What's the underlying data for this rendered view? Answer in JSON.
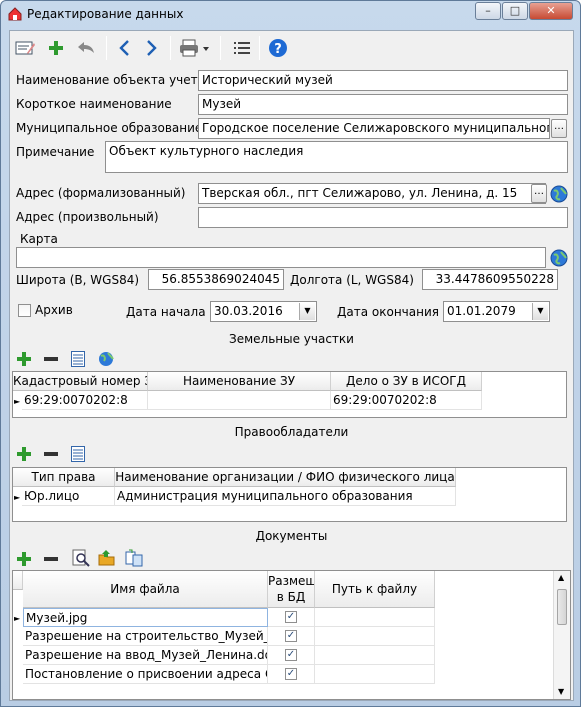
{
  "window": {
    "title": "Редактирование данных"
  },
  "toolbar": {
    "icons": [
      "edit-icon",
      "add-icon",
      "undo-icon",
      "back-icon",
      "forward-icon",
      "print-icon",
      "list-icon",
      "help-icon"
    ]
  },
  "form": {
    "name_label": "Наименование объекта учета",
    "name_value": "Исторический музей",
    "short_label": "Короткое наименование",
    "short_value": "Музей",
    "municipal_label": "Муниципальное образование",
    "municipal_value": "Городское поселение Селижаровского муниципального рай",
    "note_label": "Примечание",
    "note_value": "Объект культурного наследия",
    "address_label": "Адрес (формализованный)",
    "address_value": "Тверская обл., пгт Селижарово, ул. Ленина, д. 15",
    "address_free_label": "Адрес (произвольный)",
    "address_free_value": "",
    "map_label": "Карта",
    "map_value": "",
    "lat_label": "Широта (B, WGS84)",
    "lat_value": "56.8553869024045",
    "lon_label": "Долгота (L, WGS84)",
    "lon_value": "33.4478609550228",
    "archive_label": "Архив",
    "start_label": "Дата начала",
    "start_value": "30.03.2016",
    "end_label": "Дата окончания",
    "end_value": "01.01.2079"
  },
  "land": {
    "title": "Земельные участки",
    "headers": [
      "Кадастровый номер ЗУ",
      "Наименование ЗУ",
      "Дело о ЗУ в ИСОГД"
    ],
    "rows": [
      [
        "69:29:0070202:8",
        "",
        "69:29:0070202:8"
      ]
    ]
  },
  "owners": {
    "title": "Правообладатели",
    "headers": [
      "Тип права",
      "Наименование организации / ФИО физического лица"
    ],
    "rows": [
      [
        "Юр.лицо",
        "Администрация муниципального образования"
      ]
    ]
  },
  "documents": {
    "title": "Документы",
    "headers": [
      "Имя файла",
      "Размещен в БД",
      "Путь к файлу"
    ],
    "rows": [
      {
        "name": "Музей.jpg",
        "in_db": true,
        "path": ""
      },
      {
        "name": "Разрешение на строительство_Музей_Лен",
        "in_db": true,
        "path": ""
      },
      {
        "name": "Разрешение на ввод_Музей_Ленина.docx",
        "in_db": true,
        "path": ""
      },
      {
        "name": "Постановление о присвоении адреса ОКС",
        "in_db": true,
        "path": ""
      }
    ]
  },
  "colors": {
    "accent": "#1e5fb4",
    "add": "#2e8b2e",
    "remove": "#333333"
  }
}
